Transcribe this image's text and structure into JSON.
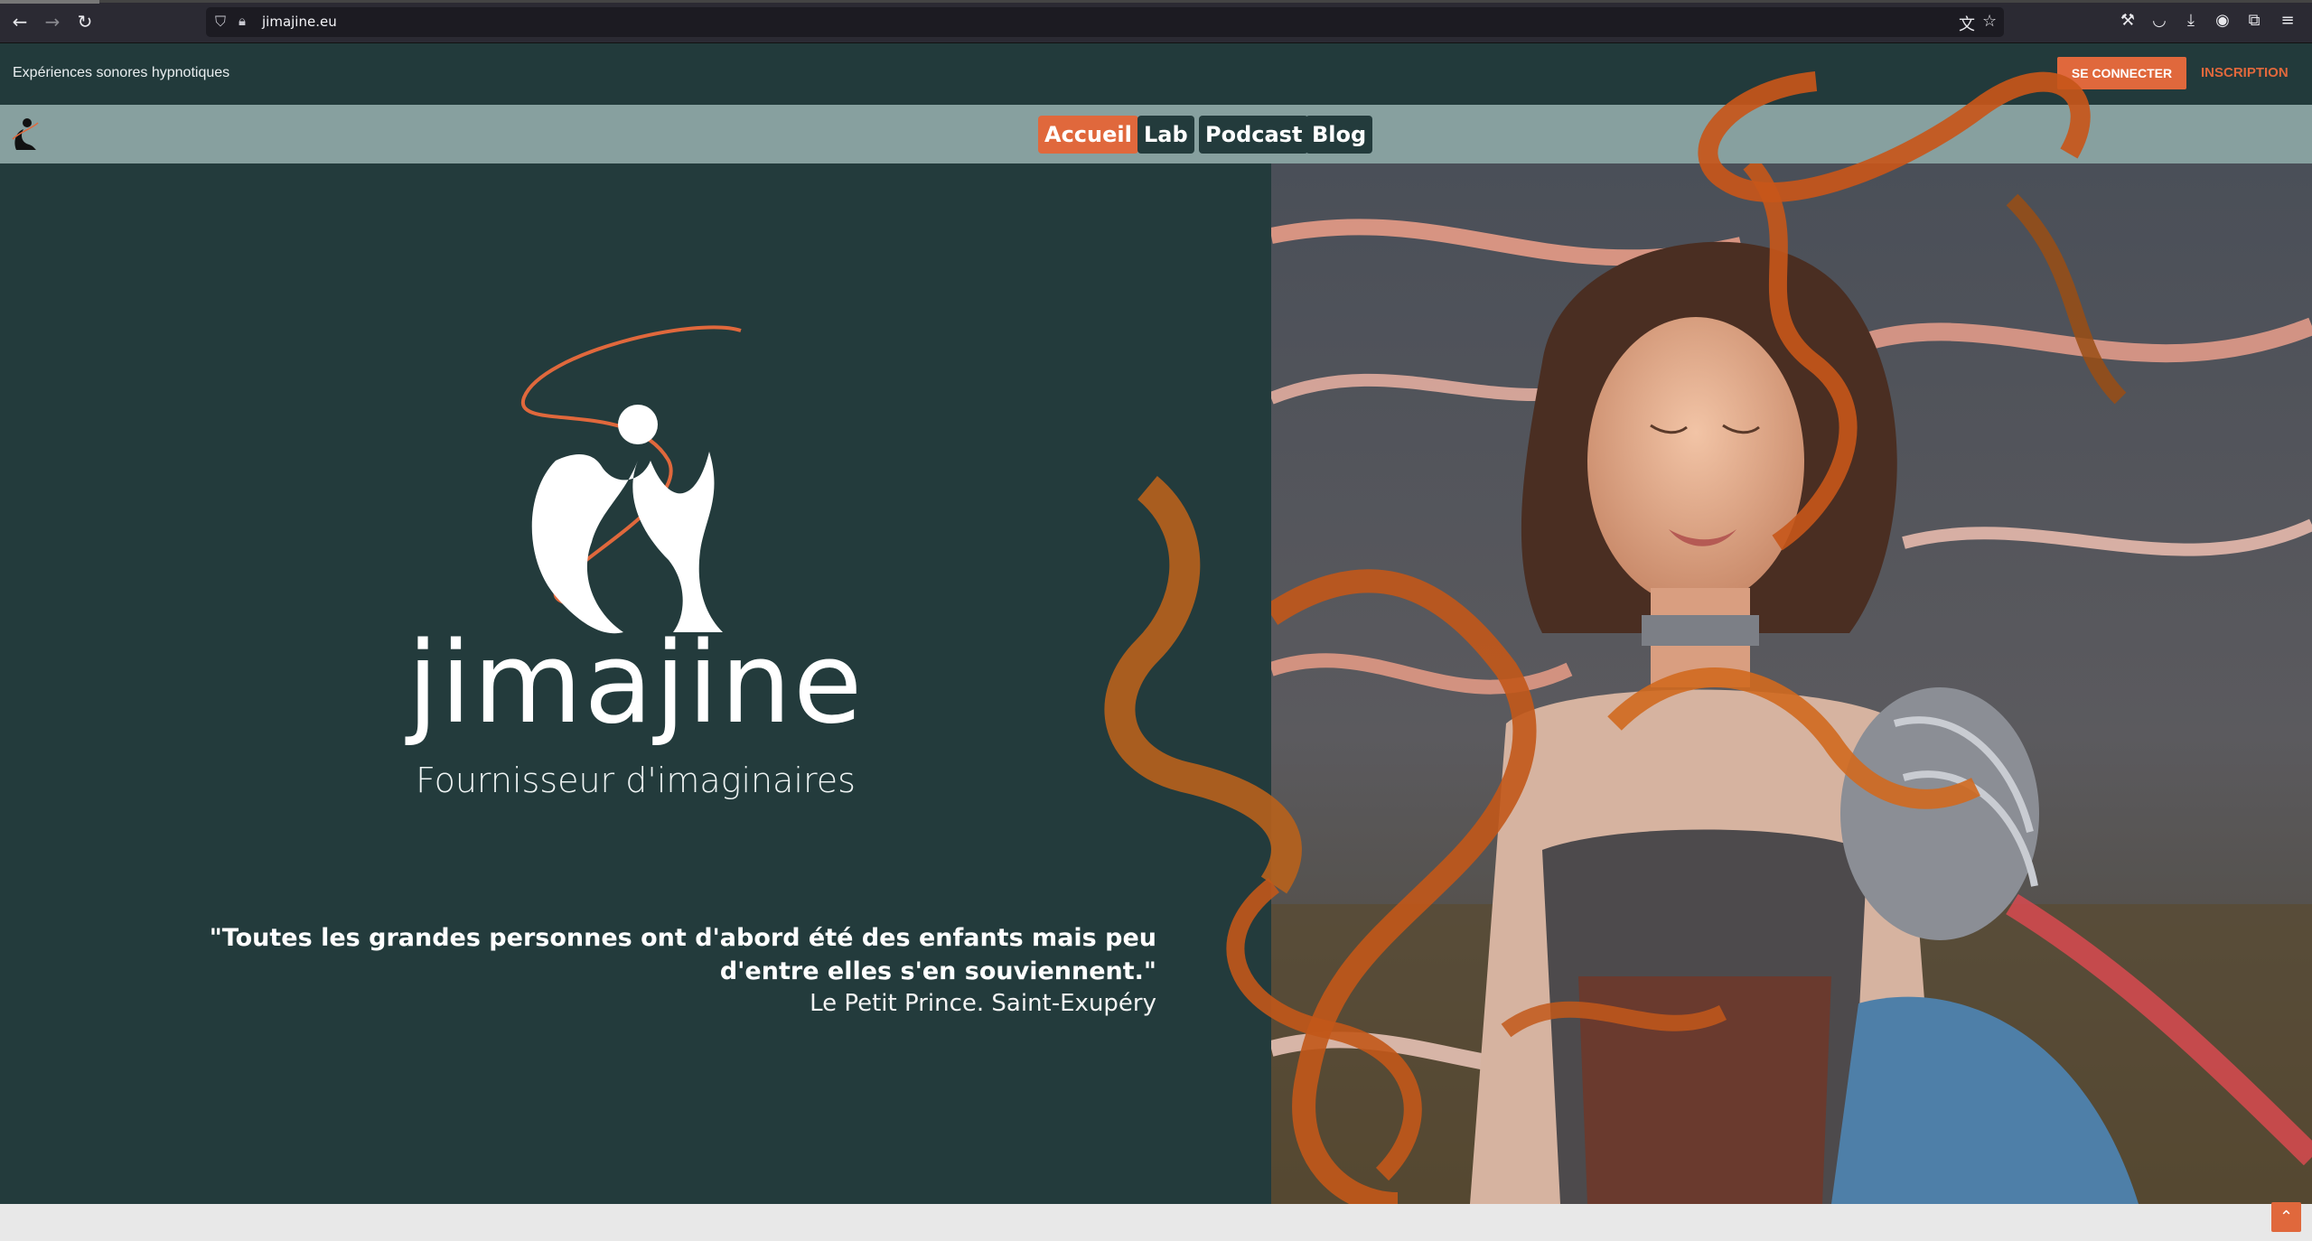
{
  "browser": {
    "url": "jimajine.eu",
    "icons": [
      "back-icon",
      "forward-icon",
      "reload-icon",
      "shield-icon",
      "lock-icon",
      "translate-icon",
      "bookmark-star-icon",
      "wrench-icon",
      "pocket-icon",
      "download-icon",
      "account-icon",
      "extensions-icon",
      "menu-icon"
    ]
  },
  "topbar": {
    "tagline": "Expériences sonores hypnotiques",
    "login_label": "SE CONNECTER",
    "signup_label": "INSCRIPTION"
  },
  "nav": {
    "items": [
      {
        "label": "Accueil",
        "active": true
      },
      {
        "label": "Lab",
        "active": false
      },
      {
        "label": "Podcast",
        "active": false
      },
      {
        "label": "Blog",
        "active": false
      }
    ]
  },
  "hero": {
    "brand_name": "JIMAJINE",
    "brand_wordmark": "jimajine",
    "subtitle": "Fournisseur d'imaginaires",
    "quote": "\"Toutes les grandes personnes ont d'abord été des enfants mais peu d'entre elles s'en souviennent.\"",
    "quote_author": "Le Petit Prince. Saint-Exupéry"
  },
  "colors": {
    "accent": "#e0683c",
    "dark_teal": "#233b3c",
    "nav_bg": "#87a09f"
  },
  "scroll_top_icon": "chevron-up-icon"
}
